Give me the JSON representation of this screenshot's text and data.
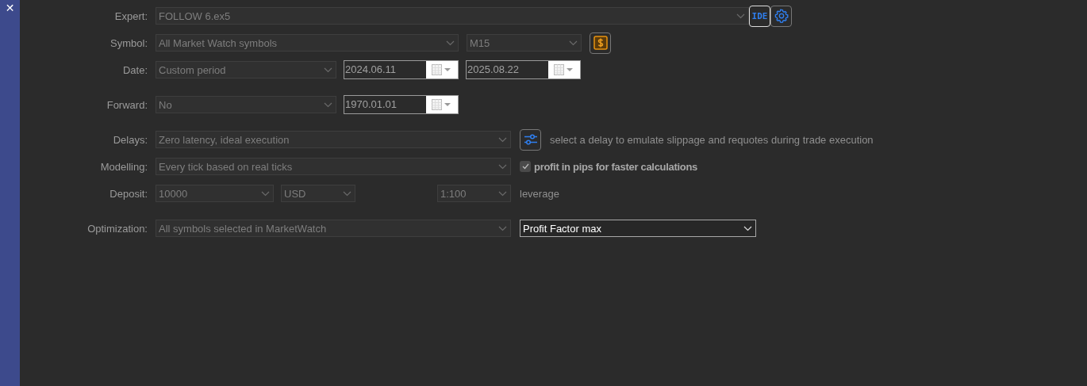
{
  "sidebar": {
    "close": "✕"
  },
  "rows": [
    {
      "label": "Expert:",
      "controls": [
        {
          "kind": "combo",
          "value": "FOLLOW 6.ex5",
          "disabled": true
        },
        {
          "kind": "button",
          "label": "IDE"
        },
        {
          "kind": "gear"
        }
      ]
    },
    {
      "label": "Symbol:",
      "controls": [
        {
          "kind": "combo",
          "value": "All Market Watch symbols",
          "disabled": true
        },
        {
          "kind": "combo",
          "value": "M15",
          "disabled": true
        },
        {
          "kind": "money"
        }
      ]
    },
    {
      "label": "Date:",
      "controls": [
        {
          "kind": "combo",
          "value": "Custom period",
          "disabled": true
        },
        {
          "kind": "date",
          "value": "2024.06.11"
        },
        {
          "kind": "date",
          "value": "2025.08.22"
        }
      ]
    },
    {
      "label": "Forward:",
      "controls": [
        {
          "kind": "combo",
          "value": "No",
          "disabled": true
        },
        {
          "kind": "date",
          "value": "1970.01.01"
        }
      ]
    },
    {
      "label": "Delays:",
      "controls": [
        {
          "kind": "combo",
          "value": "Zero latency, ideal execution",
          "disabled": true
        },
        {
          "kind": "sliders"
        },
        {
          "kind": "note",
          "text": "select a delay to emulate slippage and requotes during trade execution"
        }
      ]
    },
    {
      "label": "Modelling:",
      "controls": [
        {
          "kind": "combo",
          "value": "Every tick based on real ticks",
          "disabled": true
        },
        {
          "kind": "checkbox",
          "label": "profit in pips for faster calculations",
          "checked": true
        }
      ]
    },
    {
      "label": "Deposit:",
      "controls": [
        {
          "kind": "combo",
          "value": "10000",
          "disabled": true
        },
        {
          "kind": "combo",
          "value": "USD",
          "disabled": true
        },
        {
          "kind": "combo",
          "value": "1:100",
          "disabled": true
        },
        {
          "kind": "note",
          "text": "leverage"
        }
      ]
    },
    {
      "label": "Optimization:",
      "controls": [
        {
          "kind": "combo",
          "value": "All symbols selected in MarketWatch",
          "disabled": true
        },
        {
          "kind": "combo",
          "value": "Profit Factor max",
          "disabled": false
        }
      ]
    }
  ]
}
